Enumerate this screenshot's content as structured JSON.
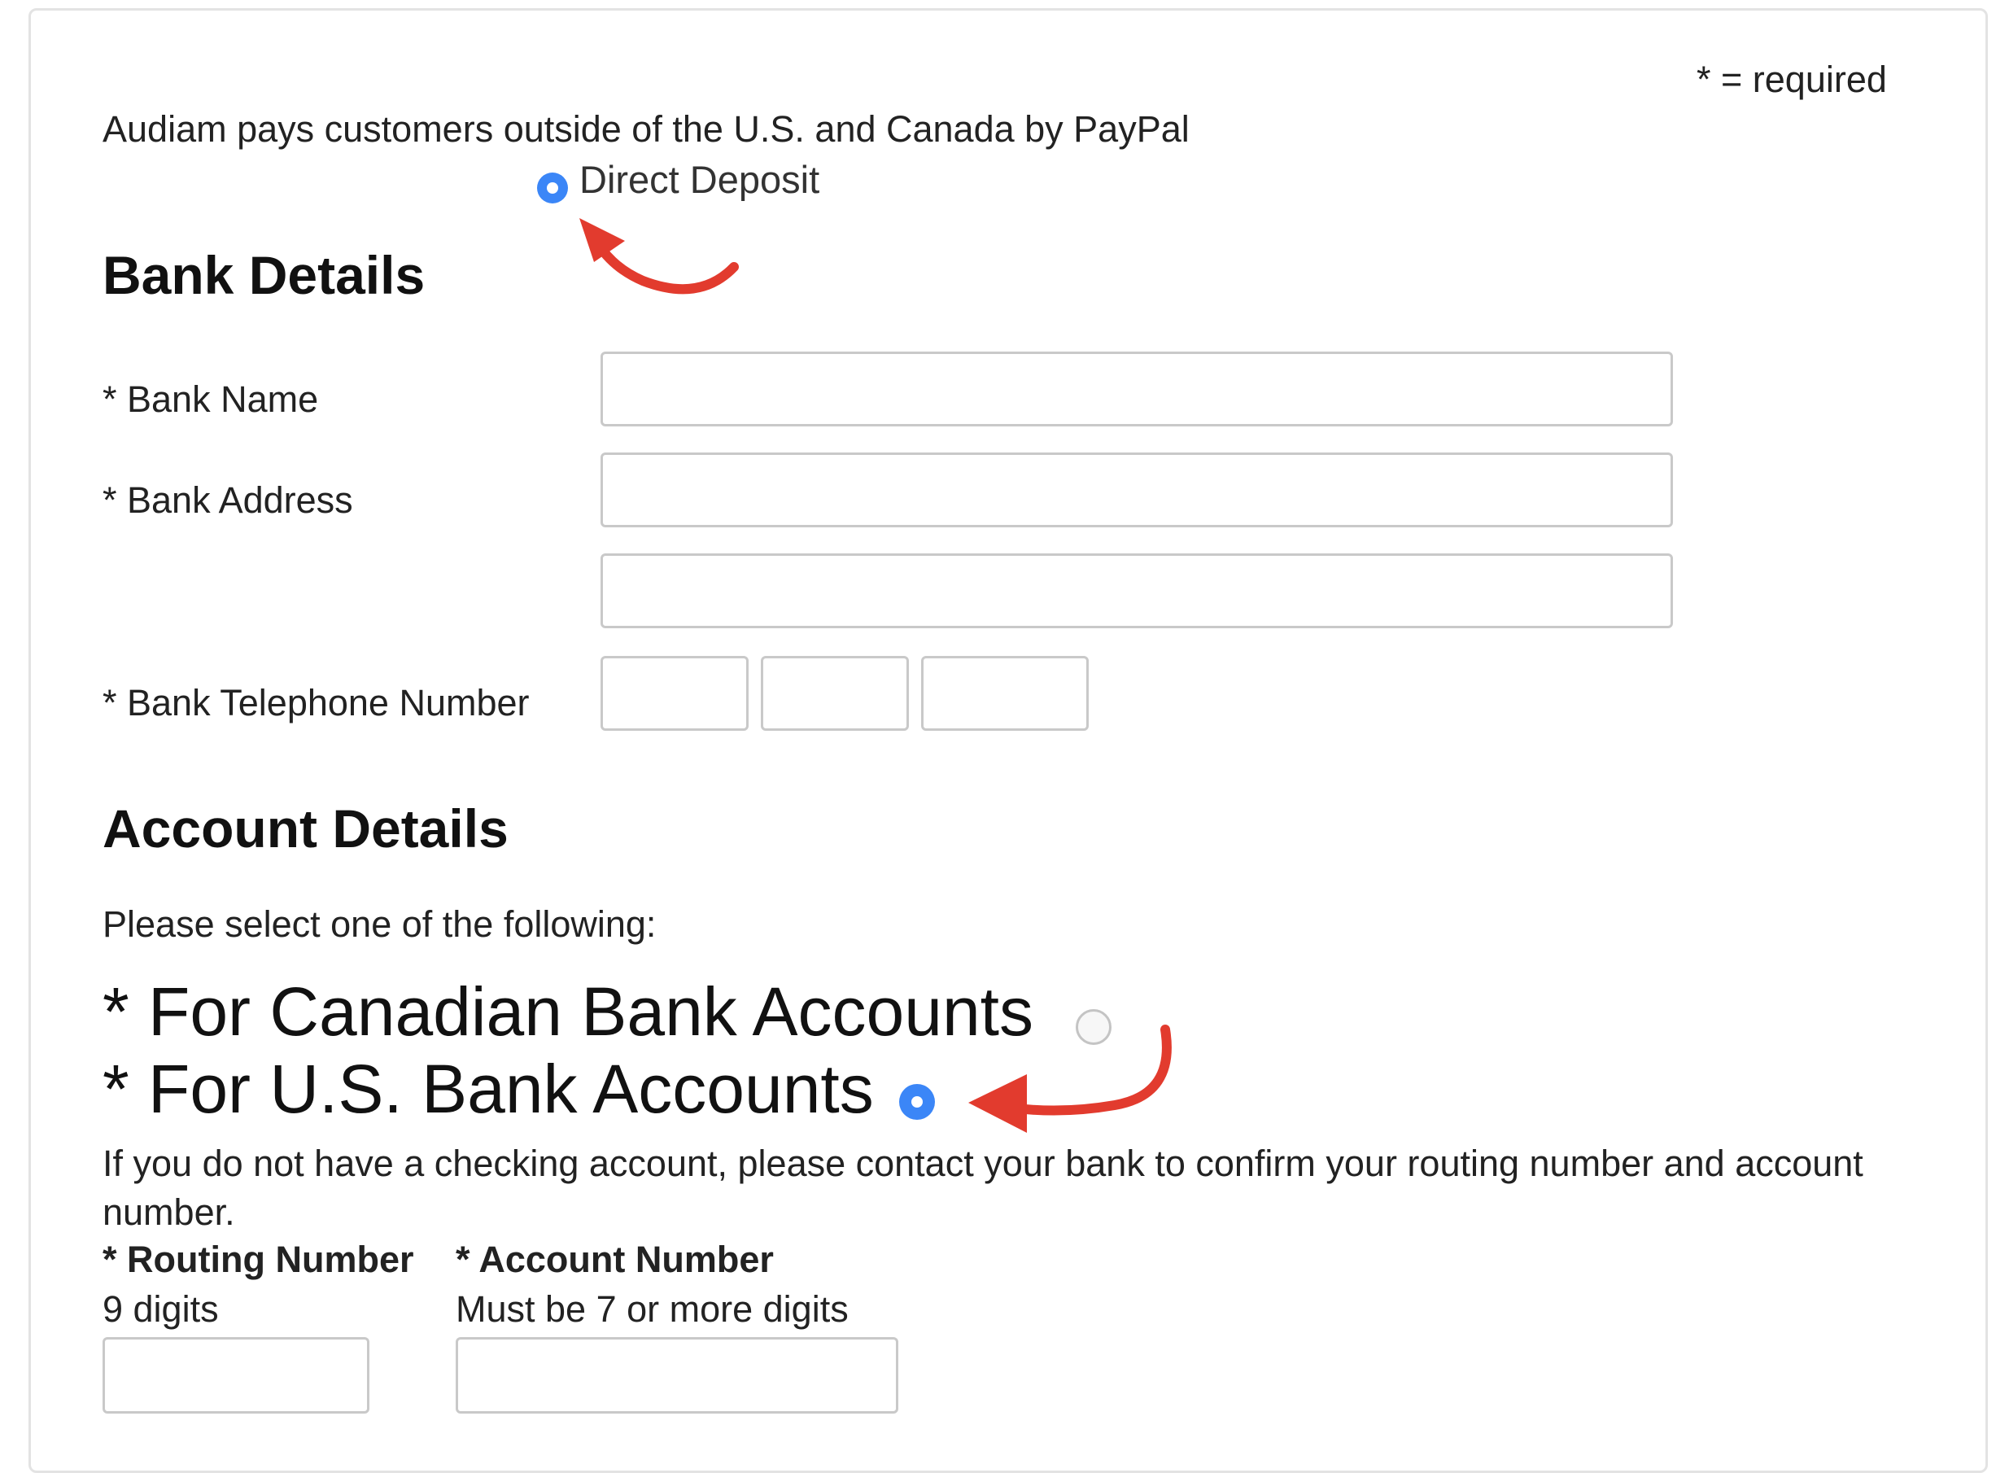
{
  "form": {
    "required_note": "* = required",
    "intro_text": "Audiam pays customers outside of the U.S. and Canada by PayPal",
    "payment_method": {
      "label": "Direct Deposit",
      "checked": true
    }
  },
  "bank_details": {
    "heading": "Bank Details",
    "bank_name_label": "* Bank Name",
    "bank_name_value": "",
    "bank_address_label": "* Bank Address",
    "bank_address_line1_value": "",
    "bank_address_line2_value": "",
    "bank_phone_label": "* Bank Telephone Number",
    "bank_phone_parts": [
      "",
      "",
      ""
    ]
  },
  "account_details": {
    "heading": "Account Details",
    "select_prompt": "Please select one of the following:",
    "options": [
      {
        "label": "* For Canadian Bank Accounts",
        "checked": false
      },
      {
        "label": "* For U.S. Bank Accounts",
        "checked": true
      }
    ],
    "help_text": "If you do not have a checking account, please contact your bank to confirm your routing number and account number.",
    "routing_label": "* Routing Number",
    "routing_hint": "9 digits",
    "routing_value": "",
    "account_label": "* Account Number",
    "account_hint": "Must be 7 or more digits",
    "account_value": ""
  },
  "colors": {
    "radio_checked": "#3b86f7",
    "annotation_arrow": "#e23b2e",
    "panel_border": "#e3e3e3",
    "input_border": "#c9c9c9"
  }
}
